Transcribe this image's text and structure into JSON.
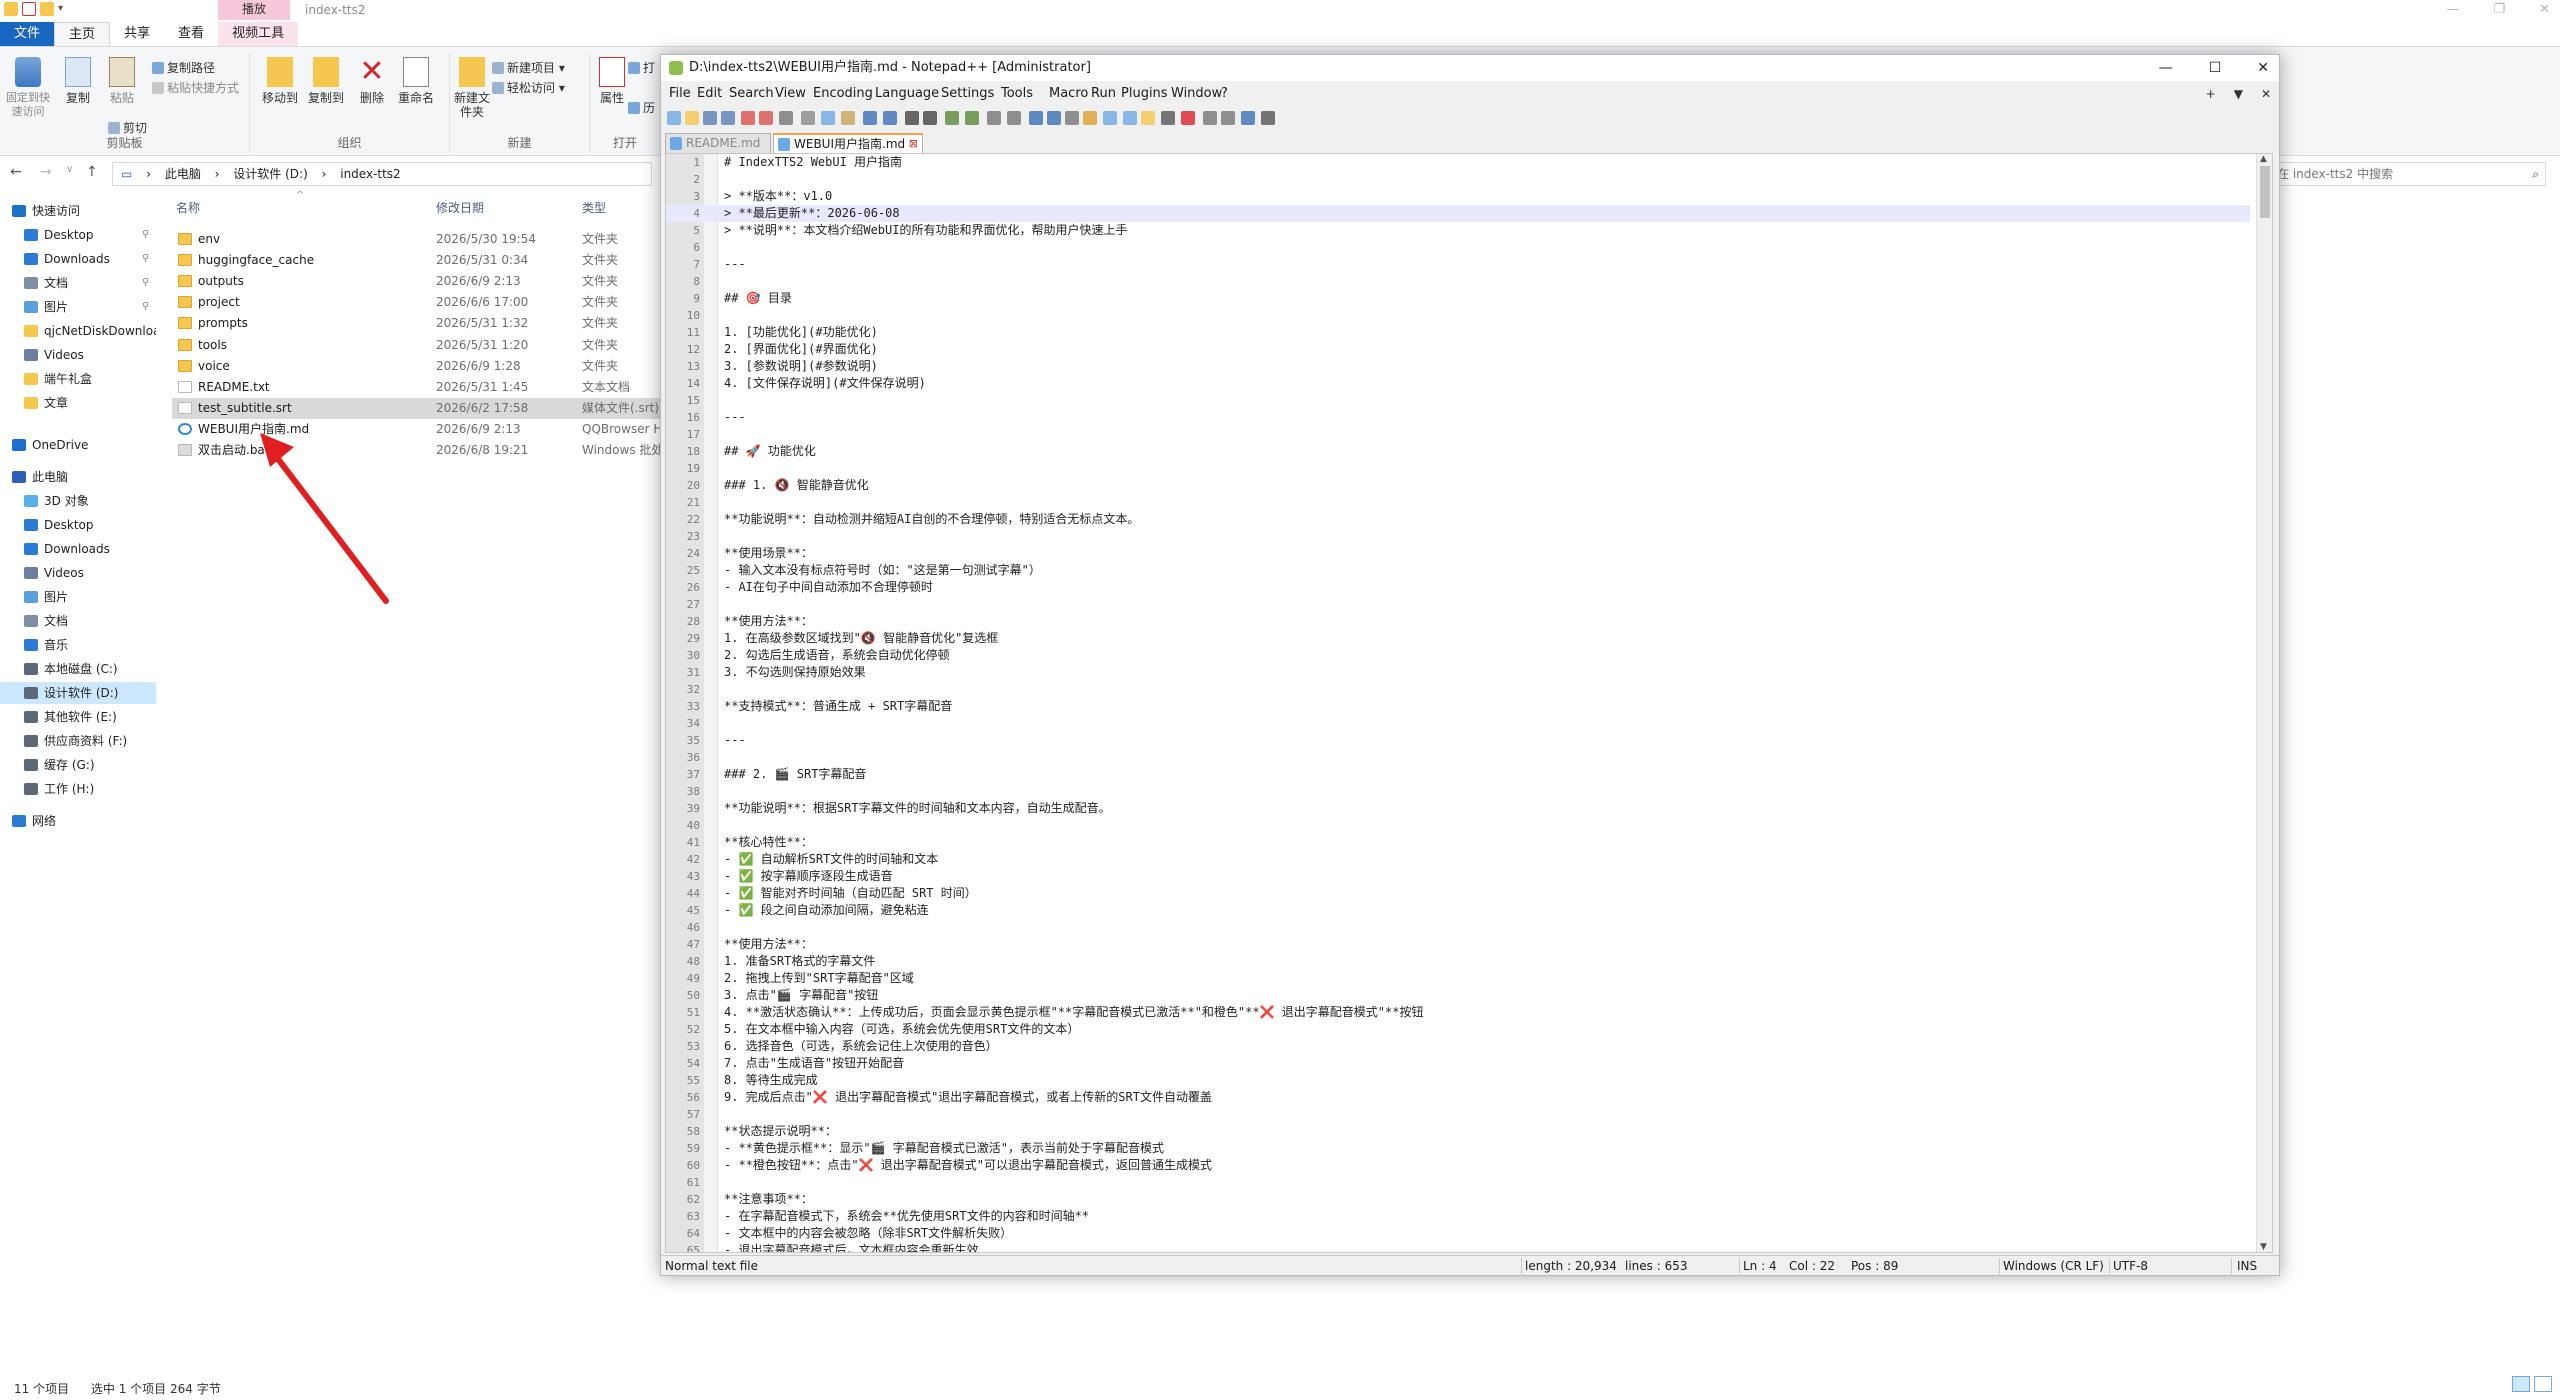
{
  "explorer": {
    "title": "index-tts2",
    "context_tab": "播放",
    "tabs": [
      "文件",
      "主页",
      "共享",
      "查看",
      "视频工具"
    ],
    "ribbon": {
      "clipboard_group": "剪贴板",
      "pin_quick_access": "固定到快速访问",
      "copy": "复制",
      "paste": "粘贴",
      "copy_path": "复制路径",
      "paste_shortcut": "粘贴快捷方式",
      "cut": "剪切",
      "organize_group": "组织",
      "move_to": "移动到",
      "copy_to": "复制到",
      "delete": "删除",
      "rename": "重命名",
      "new_group": "新建",
      "new_folder": "新建文件夹",
      "new_item": "新建项目",
      "easy_access": "轻松访问",
      "open_group": "打开",
      "properties": "属性",
      "open": "打",
      "history": "历"
    },
    "breadcrumb": [
      "此电脑",
      "设计软件 (D:)",
      "index-tts2"
    ],
    "search_placeholder": "在 index-tts2 中搜索",
    "nav": [
      {
        "label": "快速访问",
        "icon": "star-icon",
        "color": "#1a73c9"
      },
      {
        "label": "Desktop",
        "icon": "desktop-icon",
        "color": "#2b7bd4",
        "pinned": true
      },
      {
        "label": "Downloads",
        "icon": "download-icon",
        "color": "#2b7bd4",
        "pinned": true
      },
      {
        "label": "文档",
        "icon": "documents-icon",
        "color": "#7d8ea5",
        "pinned": true
      },
      {
        "label": "图片",
        "icon": "pictures-icon",
        "color": "#5aa0dc",
        "pinned": true
      },
      {
        "label": "qjcNetDiskDownload",
        "icon": "folder-icon",
        "color": "#f5c74e"
      },
      {
        "label": "Videos",
        "icon": "videos-icon",
        "color": "#6c7fa0"
      },
      {
        "label": "端午礼盒",
        "icon": "folder-icon",
        "color": "#f5c74e"
      },
      {
        "label": "文章",
        "icon": "folder-icon",
        "color": "#f5c74e"
      },
      {
        "label": "OneDrive",
        "icon": "cloud-icon",
        "color": "#1f6fd0"
      },
      {
        "label": "此电脑",
        "icon": "computer-icon",
        "color": "#2b5fb8"
      },
      {
        "label": "3D 对象",
        "icon": "3d-objects-icon",
        "color": "#58b0e8"
      },
      {
        "label": "Desktop",
        "icon": "desktop-icon",
        "color": "#2b7bd4"
      },
      {
        "label": "Downloads",
        "icon": "download-icon",
        "color": "#2b7bd4"
      },
      {
        "label": "Videos",
        "icon": "videos-icon",
        "color": "#6c7fa0"
      },
      {
        "label": "图片",
        "icon": "pictures-icon",
        "color": "#5aa0dc"
      },
      {
        "label": "文档",
        "icon": "documents-icon",
        "color": "#7d8ea5"
      },
      {
        "label": "音乐",
        "icon": "music-icon",
        "color": "#2b7bd4"
      },
      {
        "label": "本地磁盘 (C:)",
        "icon": "drive-icon",
        "color": "#5a6878"
      },
      {
        "label": "设计软件 (D:)",
        "icon": "drive-icon",
        "color": "#5a6878",
        "selected": true
      },
      {
        "label": "其他软件 (E:)",
        "icon": "drive-icon",
        "color": "#5a6878"
      },
      {
        "label": "供应商资料 (F:)",
        "icon": "drive-icon",
        "color": "#5a6878"
      },
      {
        "label": "缓存 (G:)",
        "icon": "drive-icon",
        "color": "#5a6878"
      },
      {
        "label": "工作 (H:)",
        "icon": "drive-icon",
        "color": "#5a6878"
      },
      {
        "label": "网络",
        "icon": "network-icon",
        "color": "#2b7bd4"
      }
    ],
    "columns": {
      "name": "名称",
      "date": "修改日期",
      "type": "类型"
    },
    "files": [
      {
        "name": "env",
        "date": "2026/5/30 19:54",
        "type": "文件夹",
        "icon": "folder-icon",
        "color": "#f5c74e"
      },
      {
        "name": "huggingface_cache",
        "date": "2026/5/31 0:34",
        "type": "文件夹",
        "icon": "folder-icon",
        "color": "#f5c74e"
      },
      {
        "name": "outputs",
        "date": "2026/6/9 2:13",
        "type": "文件夹",
        "icon": "folder-icon",
        "color": "#f5c74e"
      },
      {
        "name": "project",
        "date": "2026/6/6 17:00",
        "type": "文件夹",
        "icon": "folder-icon",
        "color": "#f5c74e"
      },
      {
        "name": "prompts",
        "date": "2026/5/31 1:32",
        "type": "文件夹",
        "icon": "folder-icon",
        "color": "#f5c74e"
      },
      {
        "name": "tools",
        "date": "2026/5/31 1:20",
        "type": "文件夹",
        "icon": "folder-icon",
        "color": "#f5c74e"
      },
      {
        "name": "voice",
        "date": "2026/6/9 1:28",
        "type": "文件夹",
        "icon": "folder-icon",
        "color": "#f5c74e"
      },
      {
        "name": "README.txt",
        "date": "2026/5/31 1:45",
        "type": "文本文档",
        "icon": "text-file-icon",
        "color": "#ffffff"
      },
      {
        "name": "test_subtitle.srt",
        "date": "2026/6/2 17:58",
        "type": "媒体文件(.srt)",
        "icon": "media-file-icon",
        "color": "#ffffff",
        "selected": true
      },
      {
        "name": "WEBUI用户指南.md",
        "date": "2026/6/9 2:13",
        "type": "QQBrowser HTML",
        "icon": "browser-icon",
        "color": "#2b8ad8"
      },
      {
        "name": "双击启动.bat",
        "date": "2026/6/8 19:21",
        "type": "Windows 批处理",
        "icon": "batch-file-icon",
        "color": "#dcdcdc"
      }
    ],
    "status": {
      "count": "11 个项目",
      "selected": "选中 1 个项目  264 字节"
    }
  },
  "notepad": {
    "title": "D:\\index-tts2\\WEBUI用户指南.md - Notepad++ [Administrator]",
    "menu": [
      "File",
      "Edit",
      "Search",
      "View",
      "Encoding",
      "Language",
      "Settings",
      "Tools",
      "Macro",
      "Run",
      "Plugins",
      "Window",
      "?"
    ],
    "menu_right": [
      "+",
      "▼",
      "✕"
    ],
    "tabs": [
      {
        "label": "README.md",
        "active": false
      },
      {
        "label": "WEBUI用户指南.md",
        "active": true
      }
    ],
    "current_line": 4,
    "lines": [
      "# IndexTTS2 WebUI 用户指南",
      "",
      "> **版本**：v1.0",
      "> **最后更新**：2026-06-08",
      "> **说明**：本文档介绍WebUI的所有功能和界面优化，帮助用户快速上手",
      "",
      "---",
      "",
      "## 🎯 目录",
      "",
      "1. [功能优化](#功能优化)",
      "2. [界面优化](#界面优化)",
      "3. [参数说明](#参数说明)",
      "4. [文件保存说明](#文件保存说明)",
      "",
      "---",
      "",
      "## 🚀 功能优化",
      "",
      "### 1. 🔇 智能静音优化",
      "",
      "**功能说明**：自动检测并缩短AI自创的不合理停顿，特别适合无标点文本。",
      "",
      "**使用场景**：",
      "- 输入文本没有标点符号时（如：\"这是第一句测试字幕\"）",
      "- AI在句子中间自动添加不合理停顿时",
      "",
      "**使用方法**：",
      "1. 在高级参数区域找到\"🔇 智能静音优化\"复选框",
      "2. 勾选后生成语音，系统会自动优化停顿",
      "3. 不勾选则保持原始效果",
      "",
      "**支持模式**：普通生成 + SRT字幕配音",
      "",
      "---",
      "",
      "### 2. 🎬 SRT字幕配音",
      "",
      "**功能说明**：根据SRT字幕文件的时间轴和文本内容，自动生成配音。",
      "",
      "**核心特性**：",
      "- ✅ 自动解析SRT文件的时间轴和文本",
      "- ✅ 按字幕顺序逐段生成语音",
      "- ✅ 智能对齐时间轴（自动匹配 SRT 时间）",
      "- ✅ 段之间自动添加间隔，避免粘连",
      "",
      "**使用方法**：",
      "1. 准备SRT格式的字幕文件",
      "2. 拖拽上传到\"SRT字幕配音\"区域",
      "3. 点击\"🎬 字幕配音\"按钮",
      "4. **激活状态确认**：上传成功后，页面会显示黄色提示框\"**字幕配音模式已激活**\"和橙色\"**❌ 退出字幕配音模式\"**按钮",
      "5. 在文本框中输入内容（可选，系统会优先使用SRT文件的文本）",
      "6. 选择音色（可选，系统会记住上次使用的音色）",
      "7. 点击\"生成语音\"按钮开始配音",
      "8. 等待生成完成",
      "9. 完成后点击\"❌ 退出字幕配音模式\"退出字幕配音模式，或者上传新的SRT文件自动覆盖",
      "",
      "**状态提示说明**：",
      "- **黄色提示框**：显示\"🎬 字幕配音模式已激活\"，表示当前处于字幕配音模式",
      "- **橙色按钮**：点击\"❌ 退出字幕配音模式\"可以退出字幕配音模式，返回普通生成模式",
      "",
      "**注意事项**：",
      "- 在字幕配音模式下，系统会**优先使用SRT文件的内容和时间轴**",
      "- 文本框中的内容会被忽略（除非SRT文件解析失败）",
      "- 退出字幕配音模式后，文本框内容会重新生效"
    ],
    "status": {
      "filetype": "Normal text file",
      "length": "length : 20,934",
      "lines": "lines : 653",
      "ln": "Ln : 4",
      "col": "Col : 22",
      "pos": "Pos : 89",
      "eol": "Windows (CR LF)",
      "encoding": "UTF-8",
      "mode": "INS"
    }
  }
}
